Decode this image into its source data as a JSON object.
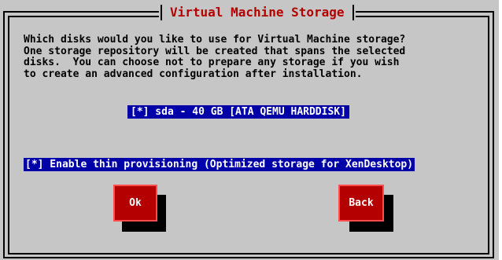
{
  "dialog": {
    "title": "Virtual Machine Storage",
    "prompt": "Which disks would you like to use for Virtual Machine storage?\nOne storage repository will be created that spans the selected\ndisks.  You can choose not to prepare any storage if you wish\nto create an advanced configuration after installation.",
    "disks": [
      {
        "label": "[*] sda - 40 GB [ATA QEMU HARDDISK]",
        "selected": true
      }
    ],
    "thin_provisioning": {
      "label": "[*] Enable thin provisioning (Optimized storage for XenDesktop)",
      "enabled": true
    },
    "buttons": {
      "ok": "Ok",
      "back": "Back"
    }
  },
  "colors": {
    "background": "#c6c6c6",
    "title_text": "#b40000",
    "highlight_bg": "#0000a8",
    "highlight_text": "#ffffff",
    "button_bg": "#b40000"
  }
}
